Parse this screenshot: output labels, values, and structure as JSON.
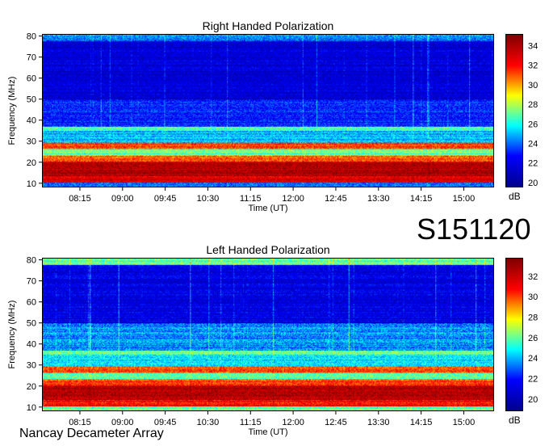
{
  "header": {
    "observation_id": "S151120",
    "instrument": "Nancay Decameter Array"
  },
  "chart_data": [
    {
      "type": "heatmap",
      "title": "Right Handed Polarization",
      "xlabel": "Time (UT)",
      "ylabel": "Frequency (MHz)",
      "x_ticks": [
        "08:15",
        "09:00",
        "09:45",
        "10:30",
        "11:15",
        "12:00",
        "12:45",
        "13:30",
        "14:15",
        "15:00"
      ],
      "x_range": [
        "07:35",
        "15:32"
      ],
      "y_ticks": [
        10,
        20,
        30,
        40,
        50,
        60,
        70,
        80
      ],
      "ylim": [
        8,
        81
      ],
      "colorbar": {
        "label": "dB",
        "ticks": [
          20,
          22,
          24,
          26,
          28,
          30,
          32,
          34
        ],
        "range": [
          19.5,
          35.2
        ]
      },
      "colormap": [
        "#00008f",
        "#0000ff",
        "#00ffff",
        "#ffff00",
        "#ff0000",
        "#800000"
      ],
      "bands": [
        {
          "f_low": 10,
          "f_high": 13,
          "db": 33
        },
        {
          "f_low": 13,
          "f_high": 20,
          "db": 34
        },
        {
          "f_low": 20,
          "f_high": 23,
          "db": 31
        },
        {
          "f_low": 23,
          "f_high": 26,
          "db": 27
        },
        {
          "f_low": 26,
          "f_high": 29,
          "db": 31
        },
        {
          "f_low": 29,
          "f_high": 35,
          "db": 25
        },
        {
          "f_low": 35,
          "f_high": 37,
          "db": 27
        },
        {
          "f_low": 37,
          "f_high": 50,
          "db": 23
        },
        {
          "f_low": 50,
          "f_high": 78,
          "db": 21.5
        },
        {
          "f_low": 78,
          "f_high": 81,
          "db": 24
        }
      ]
    },
    {
      "type": "heatmap",
      "title": "Left Handed Polarization",
      "xlabel": "Time (UT)",
      "ylabel": "Frequency (MHz)",
      "x_ticks": [
        "08:15",
        "09:00",
        "09:45",
        "10:30",
        "11:15",
        "12:00",
        "12:45",
        "13:30",
        "14:15",
        "15:00"
      ],
      "x_range": [
        "07:35",
        "15:32"
      ],
      "y_ticks": [
        10,
        20,
        30,
        40,
        50,
        60,
        70,
        80
      ],
      "ylim": [
        8,
        81
      ],
      "colorbar": {
        "label": "dB",
        "ticks": [
          20,
          22,
          24,
          26,
          28,
          30,
          32
        ],
        "range": [
          18.8,
          33.8
        ]
      },
      "colormap": [
        "#00008f",
        "#0000ff",
        "#00ffff",
        "#ffff00",
        "#ff0000",
        "#800000"
      ],
      "bands": [
        {
          "f_low": 10,
          "f_high": 13,
          "db": 31
        },
        {
          "f_low": 13,
          "f_high": 20,
          "db": 32.5
        },
        {
          "f_low": 20,
          "f_high": 23,
          "db": 30
        },
        {
          "f_low": 23,
          "f_high": 26,
          "db": 26
        },
        {
          "f_low": 26,
          "f_high": 29,
          "db": 30
        },
        {
          "f_low": 29,
          "f_high": 35,
          "db": 24.5
        },
        {
          "f_low": 35,
          "f_high": 37,
          "db": 26
        },
        {
          "f_low": 37,
          "f_high": 50,
          "db": 23.5
        },
        {
          "f_low": 50,
          "f_high": 78,
          "db": 21
        },
        {
          "f_low": 78,
          "f_high": 81,
          "db": 26
        }
      ]
    }
  ]
}
